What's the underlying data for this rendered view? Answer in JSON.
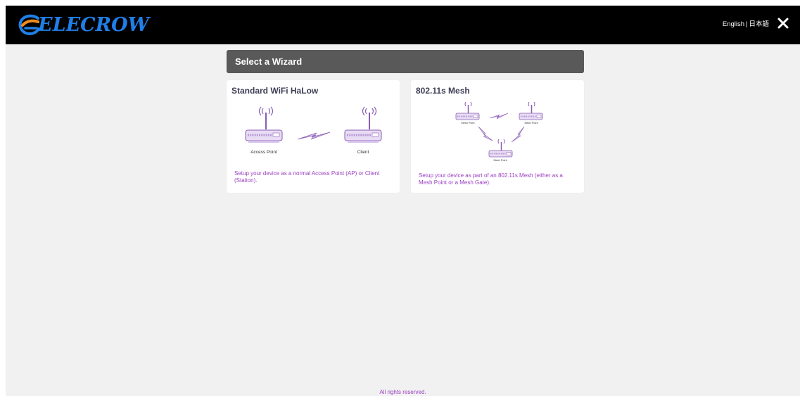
{
  "header": {
    "logo_text": "ELECROW",
    "language": {
      "english": "English",
      "separator": "|",
      "japanese": "日本語"
    },
    "icons": {
      "close": "close-icon",
      "logo": "elecrow-logo-mark"
    },
    "colors": {
      "bar": "#000000",
      "logo_blue": "#1f7fe6",
      "logo_orange": "#f08c1e"
    }
  },
  "wizard": {
    "title": "Select a Wizard",
    "cards": [
      {
        "title": "Standard WiFi HaLow",
        "diagram": {
          "left_label": "Access Point",
          "right_label": "Client"
        },
        "description": "Setup your device as a normal Access Point (AP) or Client (Station)."
      },
      {
        "title": "802.11s Mesh",
        "diagram": {
          "node_labels": [
            "Mesh Point",
            "Mesh Point",
            "Mesh Point"
          ]
        },
        "description": "Setup your device as part of an 802.11s Mesh (either as a Mesh Point or a Mesh Gate)."
      }
    ]
  },
  "footer": {
    "text": "All rights reserved."
  },
  "colors": {
    "accent_text": "#9b3fc1",
    "page_bg": "#f1f1f1",
    "wizard_header": "#595959",
    "router_fill": "#e8dcf4",
    "router_stroke": "#8a5cb5"
  }
}
